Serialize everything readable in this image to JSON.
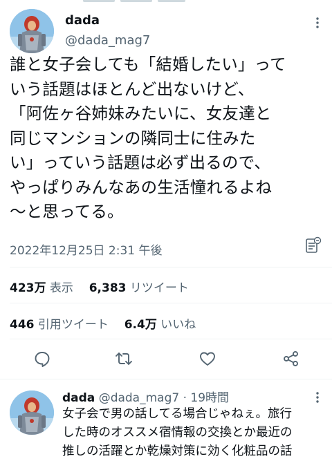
{
  "main_tweet": {
    "display_name": "dada",
    "handle": "@dada_mag7",
    "text": "誰と女子会しても「結婚したい」って\nいう話題はほとんど出ないけど、\n「阿佐ヶ谷姉妹みたいに、女友達と\n同じマンションの隣同士に住みた\nい」っていう話題は必ず出るので、\nやっぱりみんなあの生活憧れるよね\n〜と思ってる。",
    "timestamp": "2022年12月25日 2:31 午後"
  },
  "stats": {
    "views_count": "423万",
    "views_label": "表示",
    "retweets_count": "6,383",
    "retweets_label": "リツイート",
    "quotes_count": "446",
    "quotes_label": "引用ツイート",
    "likes_count": "6.4万",
    "likes_label": "いいね"
  },
  "actions": {
    "icons": [
      "reply-icon",
      "retweet-icon",
      "like-icon",
      "share-icon"
    ]
  },
  "reply": {
    "display_name": "dada",
    "handle": "@dada_mag7",
    "separator": "·",
    "time": "19時間",
    "text": "女子会で男の話してる場合じゃねぇ。旅行\nした時のオススメ宿情報の交換とか最近の\n推しの活躍とか乾燥対策に効く化粧品の話"
  },
  "colors": {
    "text_primary": "#0f1419",
    "text_secondary": "#536471",
    "divider": "#eff3f4",
    "avatar_sky": "#8fc3e8"
  }
}
